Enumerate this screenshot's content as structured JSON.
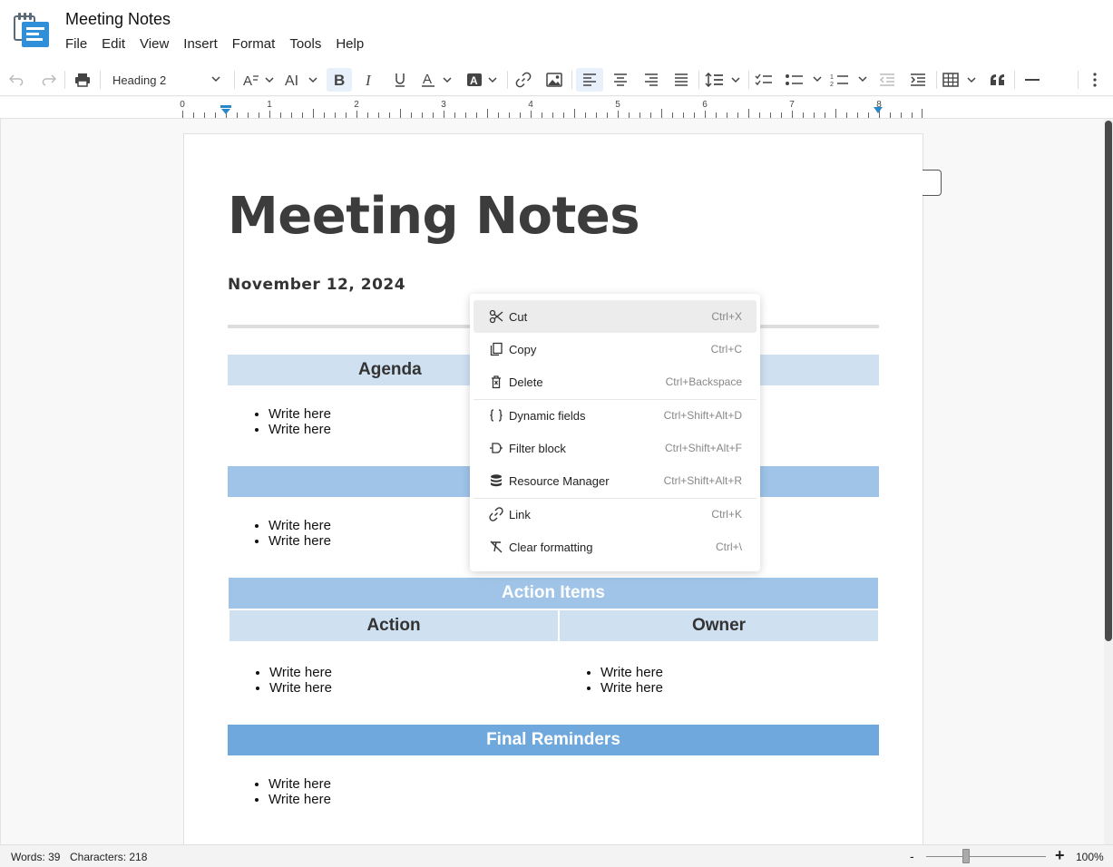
{
  "app": {
    "title": "Meeting Notes",
    "logo_icon": "notes-logo-icon"
  },
  "menu": [
    "File",
    "Edit",
    "View",
    "Insert",
    "Format",
    "Tools",
    "Help"
  ],
  "toolbar": {
    "paragraph_style": "Heading 2",
    "icons": [
      "undo-icon",
      "redo-icon",
      "print-icon",
      "font-size-icon",
      "text-case-icon",
      "bold-icon",
      "italic-icon",
      "underline-icon",
      "text-color-icon",
      "highlight-color-icon",
      "link-icon",
      "image-icon",
      "align-left-icon",
      "align-center-icon",
      "align-right-icon",
      "justify-icon",
      "line-spacing-icon",
      "checklist-icon",
      "bullet-list-icon",
      "numbered-list-icon",
      "decrease-indent-icon",
      "increase-indent-icon",
      "table-icon",
      "quote-icon",
      "horizontal-rule-icon",
      "more-icon"
    ]
  },
  "ruler": {
    "labels": [
      "0",
      "1",
      "2",
      "3",
      "4",
      "5",
      "6",
      "7",
      "8"
    ]
  },
  "document": {
    "title": "Meeting Notes",
    "date": "November 12, 2024",
    "sections": {
      "agenda": {
        "heading": "Agenda",
        "items": [
          "Write here",
          "Write here"
        ]
      },
      "second": {
        "heading": "",
        "items": [
          "Write here",
          "Write here"
        ]
      },
      "action_items": {
        "heading": "Action Items",
        "columns": [
          "Action",
          "Owner"
        ],
        "action": [
          "Write here",
          "Write here"
        ],
        "owner": [
          "Write here",
          "Write here"
        ]
      },
      "final": {
        "heading": "Final Reminders",
        "items": [
          "Write here",
          "Write here"
        ]
      }
    }
  },
  "context_menu": {
    "items": [
      {
        "label": "Cut",
        "shortcut": "Ctrl+X",
        "icon": "scissors-icon"
      },
      {
        "label": "Copy",
        "shortcut": "Ctrl+C",
        "icon": "copy-icon"
      },
      {
        "label": "Delete",
        "shortcut": "Ctrl+Backspace",
        "icon": "trash-icon"
      },
      {
        "label": "Dynamic fields",
        "shortcut": "Ctrl+Shift+Alt+D",
        "icon": "braces-icon"
      },
      {
        "label": "Filter block",
        "shortcut": "Ctrl+Shift+Alt+F",
        "icon": "filter-block-icon"
      },
      {
        "label": "Resource Manager",
        "shortcut": "Ctrl+Shift+Alt+R",
        "icon": "database-icon"
      },
      {
        "label": "Link",
        "shortcut": "Ctrl+K",
        "icon": "link-icon"
      },
      {
        "label": "Clear formatting",
        "shortcut": "Ctrl+\\",
        "icon": "clear-format-icon"
      }
    ]
  },
  "status": {
    "words": "Words: 39",
    "characters": "Characters: 218",
    "zoom_out": "-",
    "zoom_in": "+",
    "zoom": "100%",
    "zoom_level": 0.33
  },
  "colors": {
    "accent": "#1a73e8",
    "band_light": "#cfe0f1",
    "band_mid": "#9fc4e8",
    "band_dark": "#6fa8dc"
  }
}
